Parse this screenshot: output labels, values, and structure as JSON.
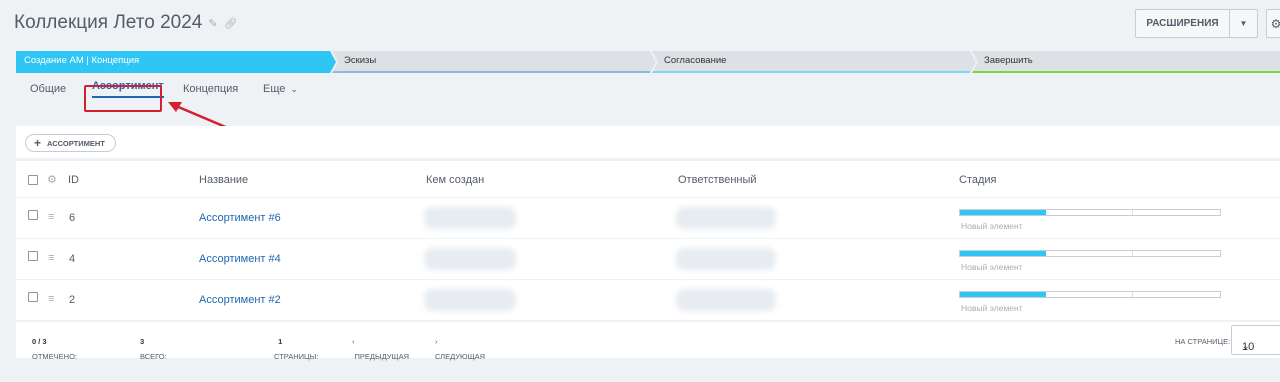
{
  "header": {
    "title": "Коллекция Лето 2024",
    "edit_icon": "pencil-icon",
    "link_icon": "link-icon"
  },
  "toolbar_top": {
    "extensions_label": "РАСШИРЕНИЯ",
    "dropdown_icon": "caret-down-icon",
    "settings_icon": "gear-icon"
  },
  "stages": [
    {
      "label": "Создание АМ | Концепция",
      "color": "#2fc6f6",
      "active": true
    },
    {
      "label": "Эскизы",
      "color": "#8fb8e6",
      "active": false
    },
    {
      "label": "Согласование",
      "color": "#7ed6f0",
      "active": false
    },
    {
      "label": "Завершить",
      "color": "#7ad93a",
      "active": false
    }
  ],
  "tabs": {
    "general": "Общие",
    "assortment": "Ассортимент",
    "concept": "Концепция",
    "more": "Еще"
  },
  "actions": {
    "add_label": "АССОРТИМЕНТ"
  },
  "grid": {
    "columns": {
      "id": "ID",
      "name": "Название",
      "created_by": "Кем создан",
      "responsible": "Ответственный",
      "stage": "Стадия"
    },
    "rows": [
      {
        "id": "6",
        "name": "Ассортимент #6",
        "stage_label": "Новый элемент",
        "stage_progress": 0.33
      },
      {
        "id": "4",
        "name": "Ассортимент #4",
        "stage_label": "Новый элемент",
        "stage_progress": 0.33
      },
      {
        "id": "2",
        "name": "Ассортимент #2",
        "stage_label": "Новый элемент",
        "stage_progress": 0.33
      }
    ]
  },
  "footer": {
    "selected_label": "ОТМЕЧЕНО:",
    "selected_value": "0 / 3",
    "total_label": "ВСЕГО:",
    "total_value": "3",
    "pages_label": "СТРАНИЦЫ:",
    "pages_value": "1",
    "prev_label": "ПРЕДЫДУЩАЯ",
    "next_label": "СЛЕДУЮЩАЯ",
    "per_page_label": "НА СТРАНИЦЕ:",
    "per_page_value": "10"
  },
  "colors": {
    "accent": "#2fc6f6",
    "link": "#2067b0",
    "highlight": "#d2202e"
  }
}
